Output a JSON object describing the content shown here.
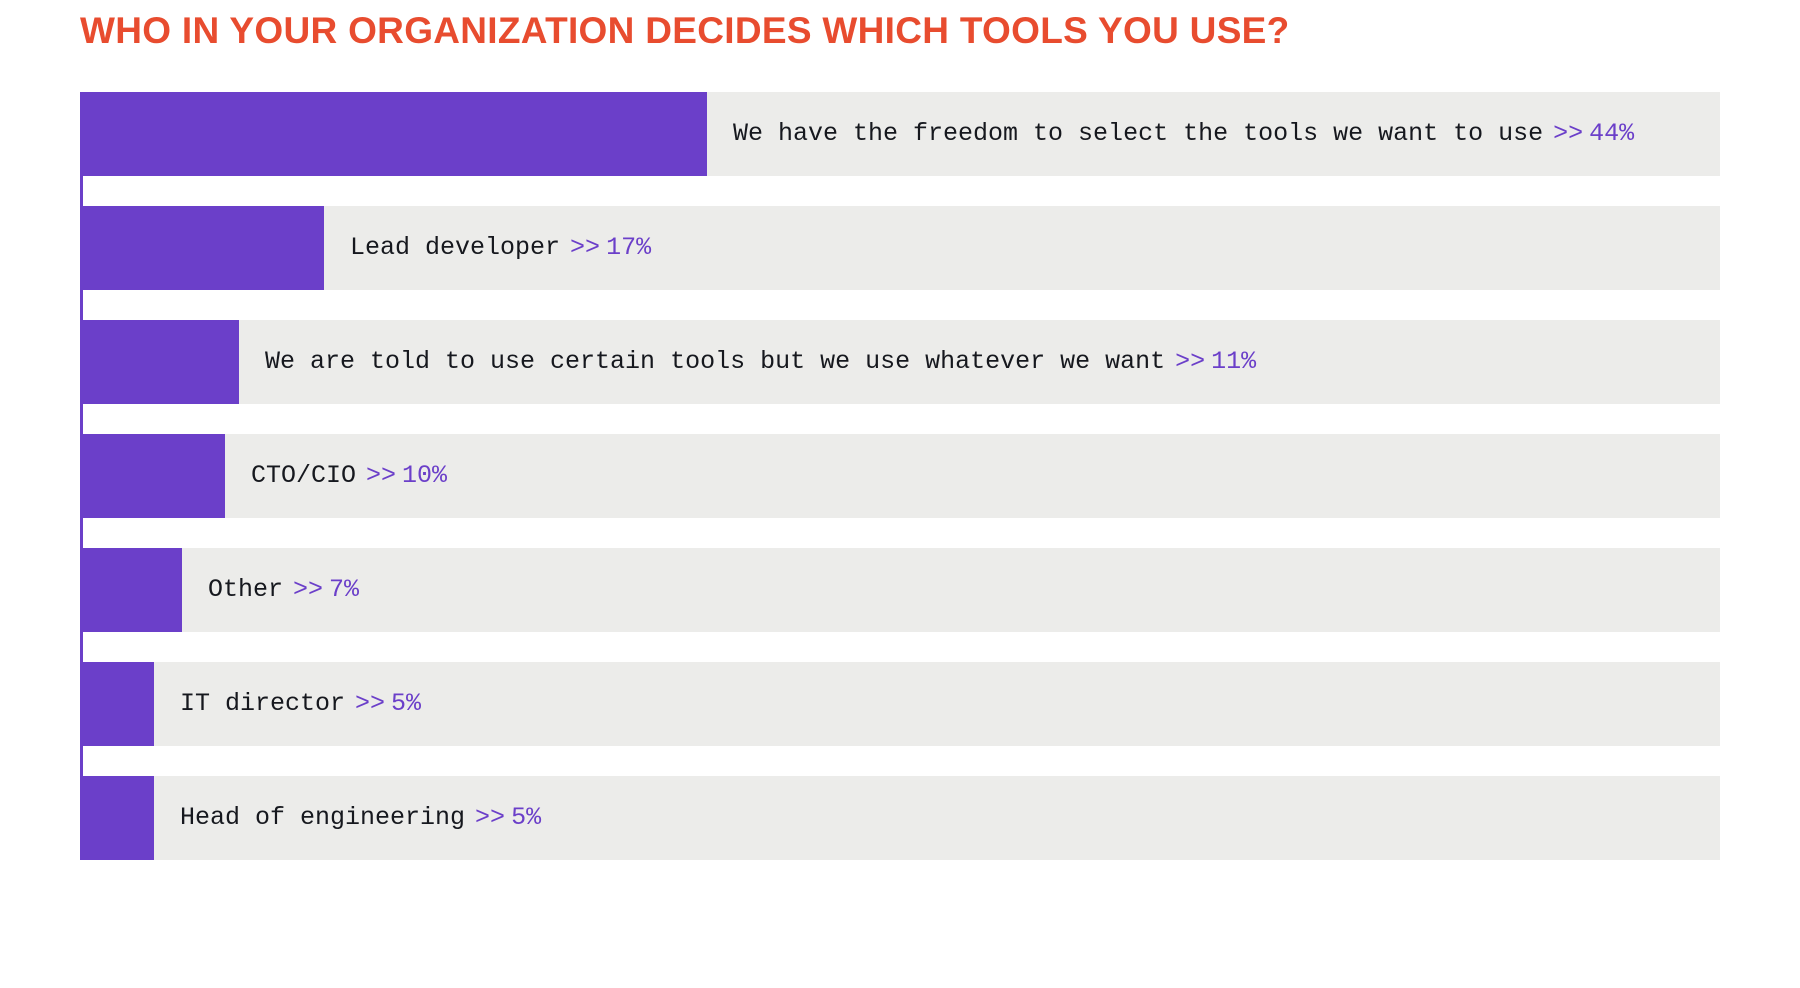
{
  "chart_data": {
    "type": "bar",
    "title": "WHO IN YOUR ORGANIZATION DECIDES WHICH TOOLS YOU USE?",
    "orientation": "horizontal",
    "xlabel": "",
    "ylabel": "",
    "xlim": [
      0,
      44
    ],
    "categories": [
      "We have the freedom to select the tools we want to use",
      "Lead developer",
      "We are told to use certain tools but we use whatever we want",
      "CTO/CIO",
      "Other",
      "IT director",
      "Head of engineering"
    ],
    "values": [
      44,
      17,
      11,
      10,
      7,
      5,
      5
    ],
    "value_suffix": "%",
    "separator": ">>",
    "colors": {
      "bar": "#6B3FC9",
      "track": "#ECECEA",
      "title": "#E84C2F",
      "text": "#16181E"
    }
  }
}
